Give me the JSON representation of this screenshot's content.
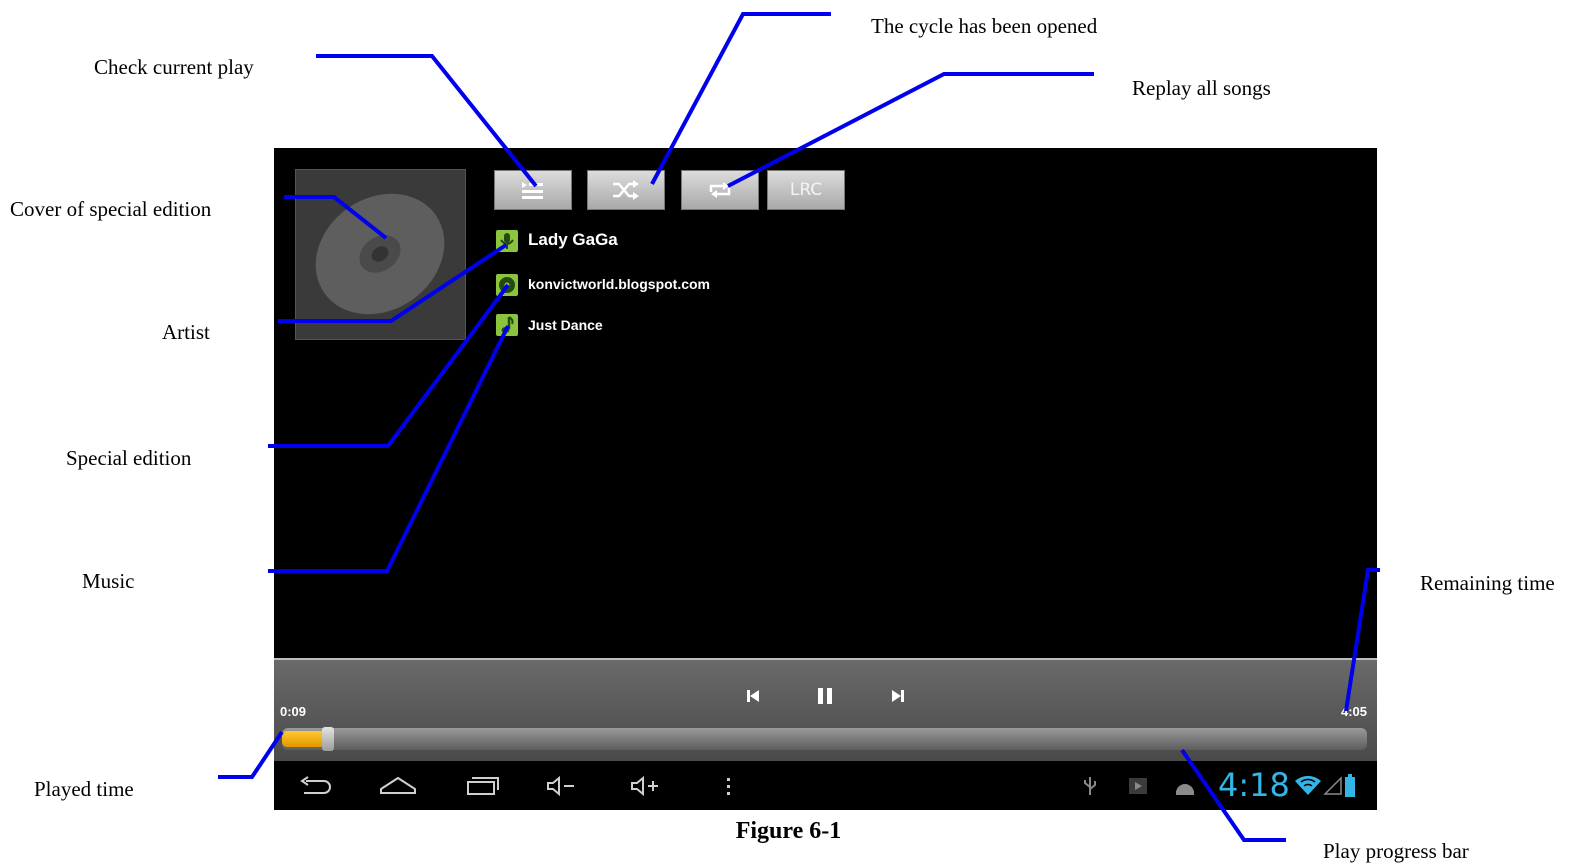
{
  "annotations": {
    "check_current_play": "Check current play",
    "cycle_opened": "The cycle has been opened",
    "replay_all": "Replay all songs",
    "cover": "Cover of special edition",
    "artist": "Artist",
    "special_edition": "Special edition",
    "music": "Music",
    "remaining_time": "Remaining time",
    "played_time": "Played time",
    "progress_bar": "Play progress bar"
  },
  "caption": "Figure 6-1",
  "toolbar": {
    "playlist_icon": "playlist-icon",
    "shuffle_icon": "shuffle-icon",
    "repeat_icon": "repeat-icon",
    "lrc_label": "LRC"
  },
  "track": {
    "artist": "Lady GaGa",
    "album": "konvictworld.blogspot.com",
    "title": "Just Dance"
  },
  "player": {
    "played_time": "0:09",
    "total_time": "4:05",
    "progress": 0.037
  },
  "status_bar": {
    "clock": "4:18"
  },
  "colors": {
    "accent_green": "#8bc53f",
    "progress_fill": "#f5b10f",
    "clock_blue": "#33b5e5",
    "callout_line": "#0000ee"
  }
}
